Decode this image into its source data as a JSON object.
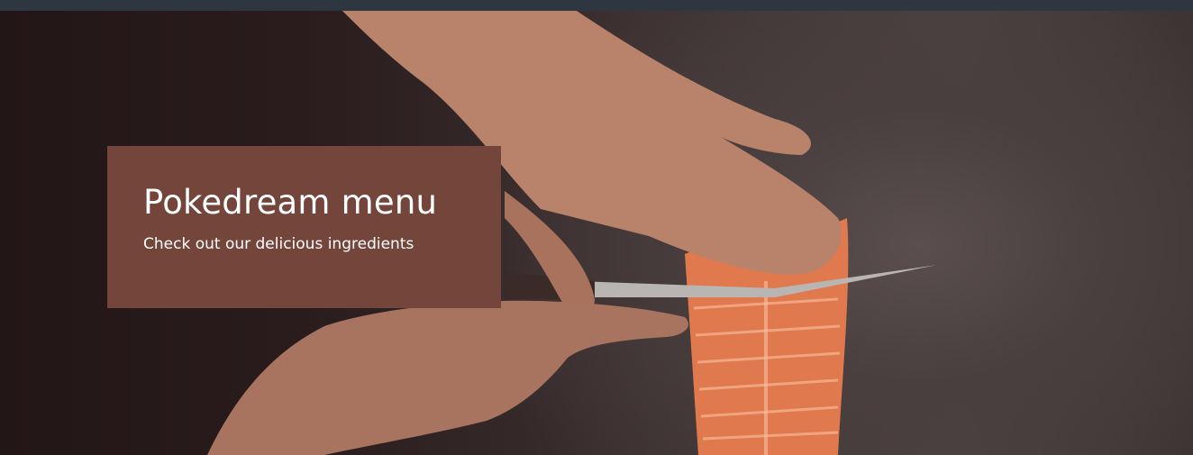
{
  "header": {
    "bar_color": "#2e3640"
  },
  "hero": {
    "image_description_icon": "salmon-fillet-photo",
    "overlay_color": "#74453a",
    "title": "Pokedream menu",
    "subtitle": "Check out our delicious ingredients"
  }
}
